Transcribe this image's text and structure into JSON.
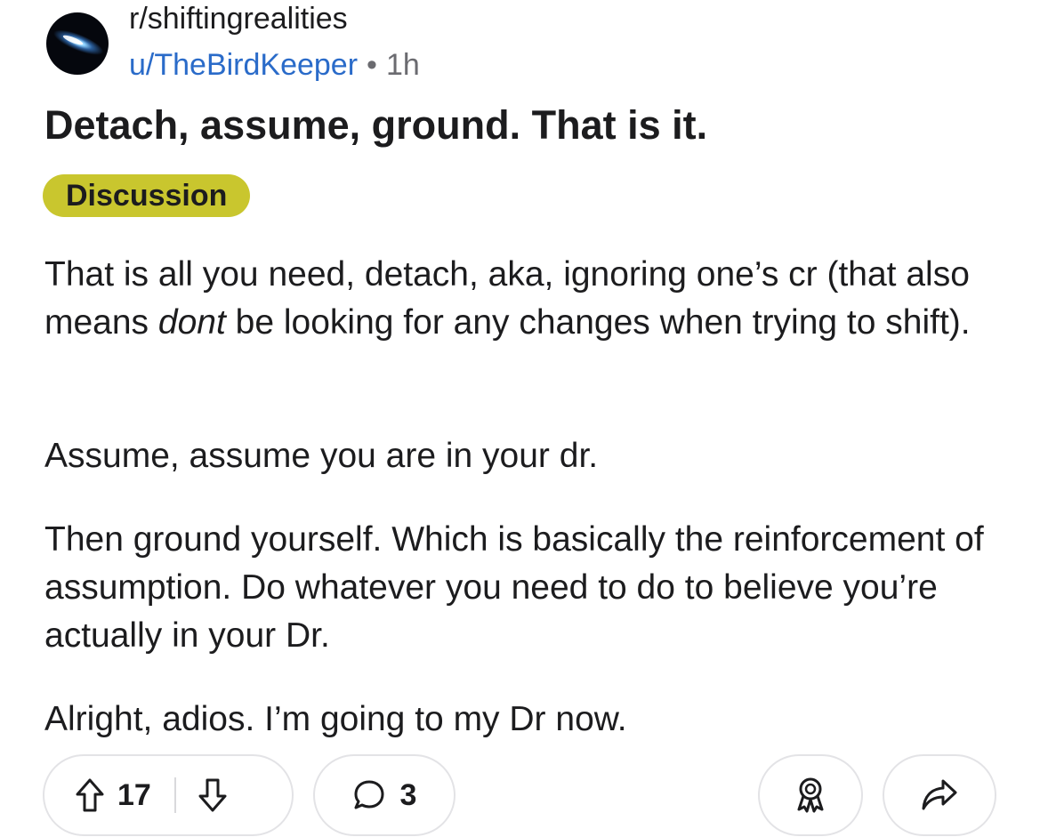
{
  "post": {
    "subreddit": "r/shiftingrealities",
    "username": "u/TheBirdKeeper",
    "separator": "•",
    "time_ago": "1h",
    "title": "Detach, assume, ground. That is it.",
    "flair": "Discussion",
    "body": {
      "p1_before": "That is all you need, detach, aka, ignoring one’s cr (that also means ",
      "p1_emphasis": "dont",
      "p1_after": " be looking for any changes when trying to shift).",
      "p2": "Assume, assume you are in your dr.",
      "p3": "Then ground yourself. Which is basically the reinforcement of assumption. Do whatever you need to do to believe you’re actually in your Dr.",
      "p4": "Alright, adios. I’m going to my Dr now."
    }
  },
  "actions": {
    "upvote_icon": "arrow-up-icon",
    "vote_count": "17",
    "downvote_icon": "arrow-down-icon",
    "comment_icon": "speech-bubble-icon",
    "comment_count": "3",
    "award_icon": "award-ribbon-icon",
    "share_icon": "share-arrow-icon"
  },
  "colors": {
    "flair_bg": "#c9c62e",
    "username": "#2a6bc9",
    "meta": "#6b6b70",
    "text": "#1c1c1e",
    "pill_border": "#e3e3e6"
  }
}
